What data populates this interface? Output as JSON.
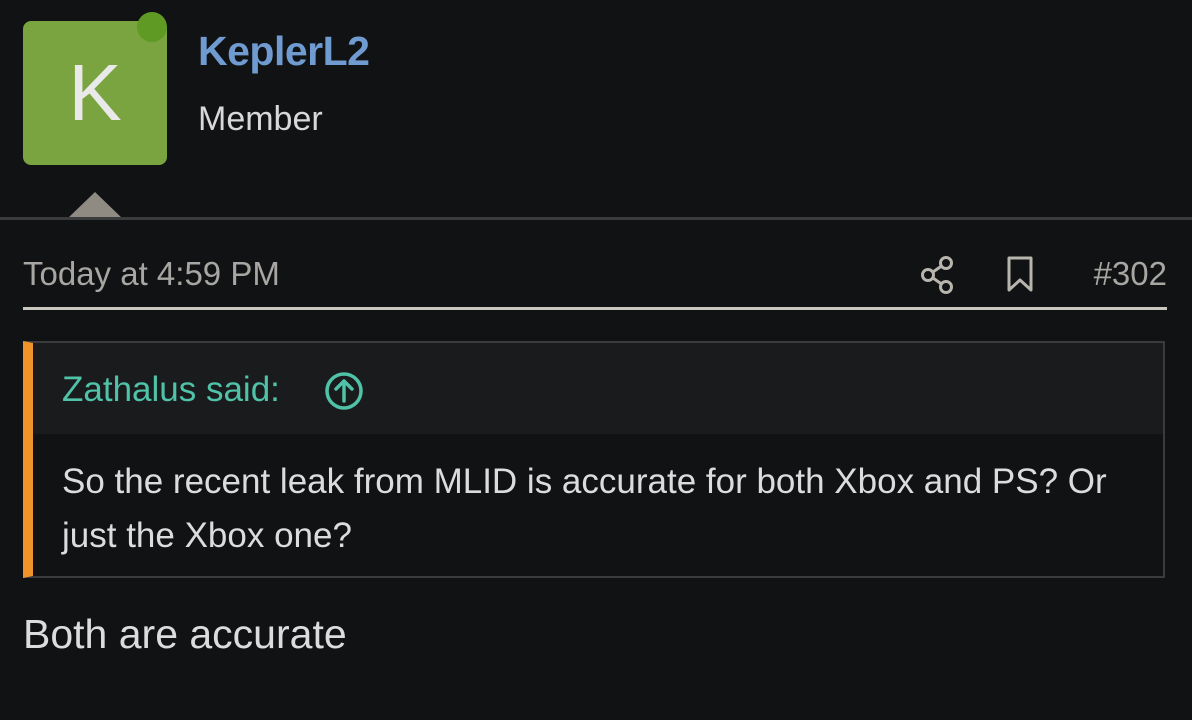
{
  "user": {
    "avatar_letter": "K",
    "name": "KeplerL2",
    "title": "Member",
    "online": true
  },
  "post": {
    "timestamp": "Today at 4:59 PM",
    "number": "#302",
    "share_icon": "share-icon",
    "bookmark_icon": "bookmark-icon"
  },
  "quote": {
    "author": "Zathalus said:",
    "arrow_icon": "arrow-up-circle-icon",
    "text": "So the recent leak from MLID is accurate for both Xbox and PS? Or just the Xbox one?"
  },
  "reply": {
    "text": "Both are accurate"
  },
  "colors": {
    "background": "#111214",
    "username": "#6f9bd0",
    "avatar": "#7aa43f",
    "online_dot": "#5f9a25",
    "quote_accent": "#f0942a",
    "quote_author": "#4fc2a8"
  }
}
